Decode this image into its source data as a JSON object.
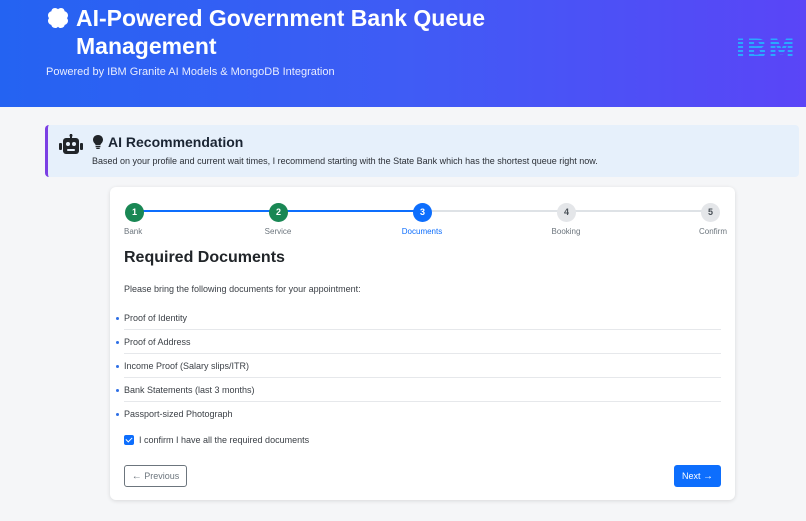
{
  "header": {
    "title": "AI-Powered Government Bank Queue Management",
    "subtitle": "Powered by IBM Granite AI Models & MongoDB Integration",
    "logo_text": "IBM",
    "gradient_start": "#2463f2",
    "gradient_end": "#5a45f7"
  },
  "recommendation": {
    "title": "AI Recommendation",
    "text": "Based on your profile and current wait times, I recommend starting with the State Bank which has the shortest queue right now.",
    "icon": "robot-icon",
    "accent": "#7b3fe4"
  },
  "stepper": {
    "steps": [
      {
        "number": "1",
        "label": "Bank",
        "state": "completed"
      },
      {
        "number": "2",
        "label": "Service",
        "state": "completed"
      },
      {
        "number": "3",
        "label": "Documents",
        "state": "active"
      },
      {
        "number": "4",
        "label": "Booking",
        "state": "pending"
      },
      {
        "number": "5",
        "label": "Confirm",
        "state": "pending"
      }
    ],
    "completed_color": "#198754",
    "active_color": "#0d6efd"
  },
  "documents": {
    "heading": "Required Documents",
    "intro": "Please bring the following documents for your appointment:",
    "items": [
      "Proof of Identity",
      "Proof of Address",
      "Income Proof (Salary slips/ITR)",
      "Bank Statements (last 3 months)",
      "Passport-sized Photograph"
    ],
    "confirm_label": "I confirm I have all the required documents",
    "confirm_checked": true
  },
  "nav": {
    "prev_label": "Previous",
    "next_label": "Next"
  }
}
